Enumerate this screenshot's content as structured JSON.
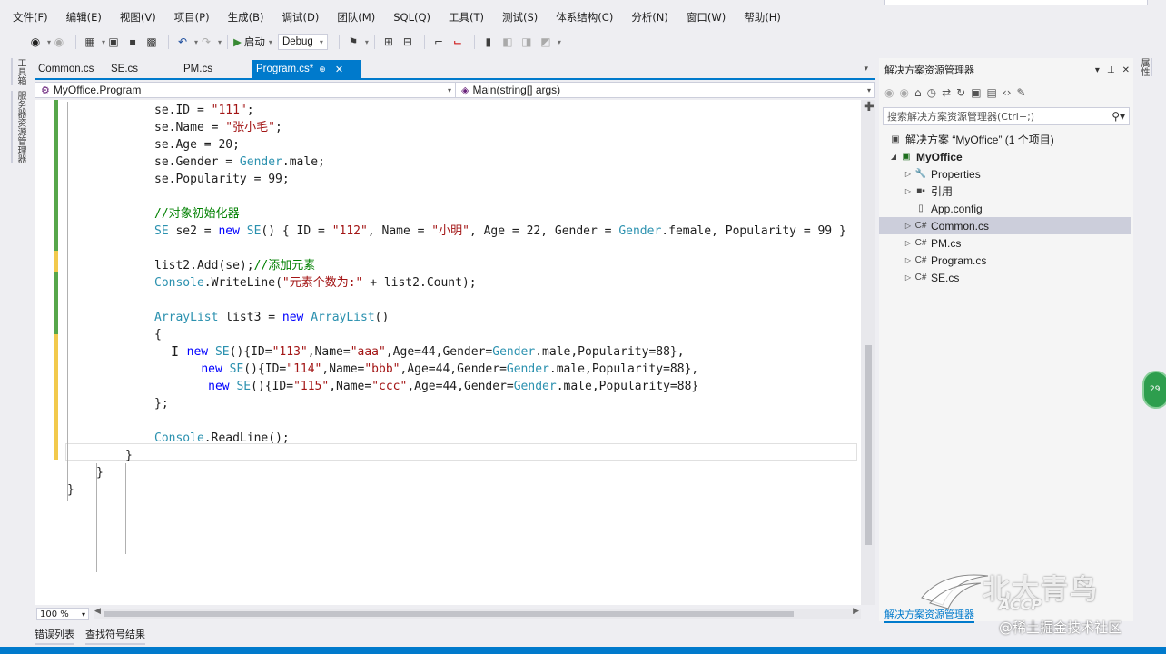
{
  "menu": [
    "文件(F)",
    "编辑(E)",
    "视图(V)",
    "项目(P)",
    "生成(B)",
    "调试(D)",
    "团队(M)",
    "SQL(Q)",
    "工具(T)",
    "测试(S)",
    "体系结构(C)",
    "分析(N)",
    "窗口(W)",
    "帮助(H)"
  ],
  "toolbar": {
    "start_label": "启动",
    "config_value": "Debug"
  },
  "side_tabs": [
    "工具箱",
    "服务器资源管理器"
  ],
  "doc_tabs": [
    "Common.cs",
    "SE.cs",
    "PM.cs",
    "Program.cs*"
  ],
  "navbar": {
    "class_value": "MyOffice.Program",
    "member_value": "Main(string[] args)"
  },
  "code_lines": [
    [
      [
        "pl",
        "se.ID = "
      ],
      [
        "st",
        "\"111\""
      ],
      [
        "pl",
        ";"
      ]
    ],
    [
      [
        "pl",
        "se.Name = "
      ],
      [
        "st",
        "\"张小毛\""
      ],
      [
        "pl",
        ";"
      ]
    ],
    [
      [
        "pl",
        "se.Age = 20;"
      ]
    ],
    [
      [
        "pl",
        "se.Gender = "
      ],
      [
        "ty",
        "Gender"
      ],
      [
        "pl",
        ".male;"
      ]
    ],
    [
      [
        "pl",
        "se.Popularity = 99;"
      ]
    ],
    [],
    [
      [
        "cm",
        "//对象初始化器"
      ]
    ],
    [
      [
        "ty",
        "SE"
      ],
      [
        "pl",
        " se2 = "
      ],
      [
        "kw",
        "new"
      ],
      [
        "pl",
        " "
      ],
      [
        "ty",
        "SE"
      ],
      [
        "pl",
        "() { ID = "
      ],
      [
        "st",
        "\"112\""
      ],
      [
        "pl",
        ", Name = "
      ],
      [
        "st",
        "\"小明\""
      ],
      [
        "pl",
        ", Age = 22, Gender = "
      ],
      [
        "ty",
        "Gender"
      ],
      [
        "pl",
        ".female, Popularity = 99 }"
      ]
    ],
    [],
    [
      [
        "pl",
        "list2.Add(se);"
      ],
      [
        "cm",
        "//添加元素"
      ]
    ],
    [
      [
        "ty",
        "Console"
      ],
      [
        "pl",
        ".WriteLine("
      ],
      [
        "st",
        "\"元素个数为:\""
      ],
      [
        "pl",
        " + list2.Count);"
      ]
    ],
    [],
    [
      [
        "ty",
        "ArrayList"
      ],
      [
        "pl",
        " list3 = "
      ],
      [
        "kw",
        "new"
      ],
      [
        "pl",
        " "
      ],
      [
        "ty",
        "ArrayList"
      ],
      [
        "pl",
        "()"
      ]
    ],
    [
      [
        "pl",
        "{"
      ]
    ],
    [
      [
        "pl",
        "  "
      ],
      [
        "kw",
        "new"
      ],
      [
        "pl",
        " "
      ],
      [
        "ty",
        "SE"
      ],
      [
        "pl",
        "(){ID="
      ],
      [
        "st",
        "\"113\""
      ],
      [
        "pl",
        ",Name="
      ],
      [
        "st",
        "\"aaa\""
      ],
      [
        "pl",
        ",Age=44,Gender="
      ],
      [
        "ty",
        "Gender"
      ],
      [
        "pl",
        ".male,Popularity=88},"
      ]
    ],
    [
      [
        "pl",
        "    "
      ],
      [
        "kw",
        "new"
      ],
      [
        "pl",
        " "
      ],
      [
        "ty",
        "SE"
      ],
      [
        "pl",
        "(){ID="
      ],
      [
        "st",
        "\"114\""
      ],
      [
        "pl",
        ",Name="
      ],
      [
        "st",
        "\"bbb\""
      ],
      [
        "pl",
        ",Age=44,Gender="
      ],
      [
        "ty",
        "Gender"
      ],
      [
        "pl",
        ".male,Popularity=88},"
      ]
    ],
    [
      [
        "pl",
        "     "
      ],
      [
        "kw",
        "new"
      ],
      [
        "pl",
        " "
      ],
      [
        "ty",
        "SE"
      ],
      [
        "pl",
        "(){ID="
      ],
      [
        "st",
        "\"115\""
      ],
      [
        "pl",
        ",Name="
      ],
      [
        "st",
        "\"ccc\""
      ],
      [
        "pl",
        ",Age=44,Gender="
      ],
      [
        "ty",
        "Gender"
      ],
      [
        "pl",
        ".male,Popularity=88}"
      ]
    ],
    [
      [
        "pl",
        "};"
      ]
    ],
    [],
    [
      [
        "ty",
        "Console"
      ],
      [
        "pl",
        ".ReadLine();"
      ]
    ],
    [
      [
        "pl",
        "}"
      ]
    ],
    [
      [
        "pl",
        "}"
      ]
    ],
    [
      [
        "pl",
        "}"
      ]
    ]
  ],
  "zoom": "100 %",
  "bottom_tabs": [
    "错误列表",
    "查找符号结果"
  ],
  "solution_explorer": {
    "title": "解决方案资源管理器",
    "search_placeholder": "搜索解决方案资源管理器(Ctrl+;)",
    "footer_tab": "解决方案资源管理器",
    "tree": [
      {
        "label": "解决方案 “MyOffice” (1 个项目)",
        "icon": "solution-icon",
        "bold": false
      },
      {
        "label": "MyOffice",
        "icon": "project-icon",
        "bold": true
      },
      {
        "label": "Properties",
        "icon": "wrench-icon",
        "bold": false
      },
      {
        "label": "引用",
        "icon": "references-icon",
        "bold": false
      },
      {
        "label": "App.config",
        "icon": "config-icon",
        "bold": false
      },
      {
        "label": "Common.cs",
        "icon": "csharp-file-icon",
        "bold": false
      },
      {
        "label": "PM.cs",
        "icon": "csharp-file-icon",
        "bold": false
      },
      {
        "label": "Program.cs",
        "icon": "csharp-file-icon",
        "bold": false
      },
      {
        "label": "SE.cs",
        "icon": "csharp-file-icon",
        "bold": false
      }
    ]
  },
  "right_side_tab": "属性",
  "badge": "29",
  "watermark": {
    "logo_text": "北大青鸟",
    "logo_sub": "ACCP",
    "site": "@稀土掘金技术社区"
  },
  "colors": {
    "accent": "#007ACC",
    "keyword": "#0000FF",
    "type": "#2B91AF",
    "string": "#A31515",
    "comment": "#008000"
  }
}
